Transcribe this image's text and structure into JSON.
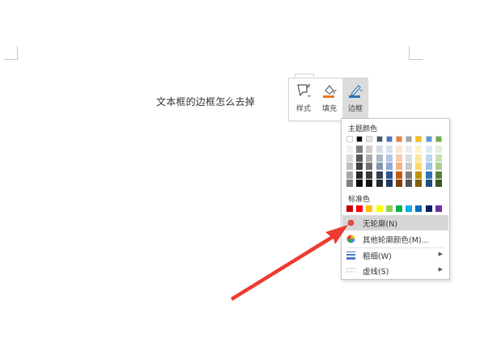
{
  "document": {
    "text": "文本框的边框怎么去掉"
  },
  "toolbar": {
    "style_label": "样式",
    "fill_label": "填充",
    "border_label": "边框",
    "fill_color": "#e87722",
    "border_color": "#2e75b6"
  },
  "menu": {
    "theme_colors_label": "主题颜色",
    "standard_colors_label": "标准色",
    "theme_top": [
      "#ffffff",
      "#000000",
      "#e7e6e6",
      "#44546a",
      "#4472c4",
      "#ed7d31",
      "#a5a5a5",
      "#ffc000",
      "#5b9bd5",
      "#70ad47"
    ],
    "theme_columns": [
      [
        "#f2f2f2",
        "#d9d9d9",
        "#bfbfbf",
        "#a6a6a6",
        "#7f7f7f"
      ],
      [
        "#7f7f7f",
        "#595959",
        "#404040",
        "#262626",
        "#0d0d0d"
      ],
      [
        "#d0cece",
        "#aeabab",
        "#757171",
        "#3a3838",
        "#171616"
      ],
      [
        "#d6dce4",
        "#adb9ca",
        "#8497b0",
        "#333f4f",
        "#222a35"
      ],
      [
        "#d9e2f3",
        "#b4c6e7",
        "#8eaadb",
        "#2f5496",
        "#1f3864"
      ],
      [
        "#fbe5d5",
        "#f7caac",
        "#f4b183",
        "#c55a11",
        "#843c0b"
      ],
      [
        "#ededed",
        "#dbdbdb",
        "#c9c9c9",
        "#7b7b7b",
        "#525252"
      ],
      [
        "#fff2cc",
        "#fee599",
        "#ffd965",
        "#bf9000",
        "#7f6000"
      ],
      [
        "#deebf6",
        "#bdd7ee",
        "#9dc3e6",
        "#2e75b5",
        "#1f4e79"
      ],
      [
        "#e2efd9",
        "#c5e0b3",
        "#a8d08d",
        "#538135",
        "#375623"
      ]
    ],
    "standard": [
      "#c00000",
      "#ff0000",
      "#ffc000",
      "#ffff00",
      "#92d050",
      "#00b050",
      "#00b0f0",
      "#0070c0",
      "#002060",
      "#7030a0"
    ],
    "items": [
      {
        "label": "无轮廓(N)",
        "icon": "no-outline-icon",
        "submenu": false
      },
      {
        "label": "其他轮廓颜色(M)...",
        "icon": "color-wheel-icon",
        "submenu": false
      },
      {
        "label": "粗细(W)",
        "icon": "line-weight-icon",
        "submenu": true
      },
      {
        "label": "虚线(S)",
        "icon": "dash-line-icon",
        "submenu": true
      }
    ]
  },
  "annotation": {
    "arrow_color": "#ee3b32"
  }
}
